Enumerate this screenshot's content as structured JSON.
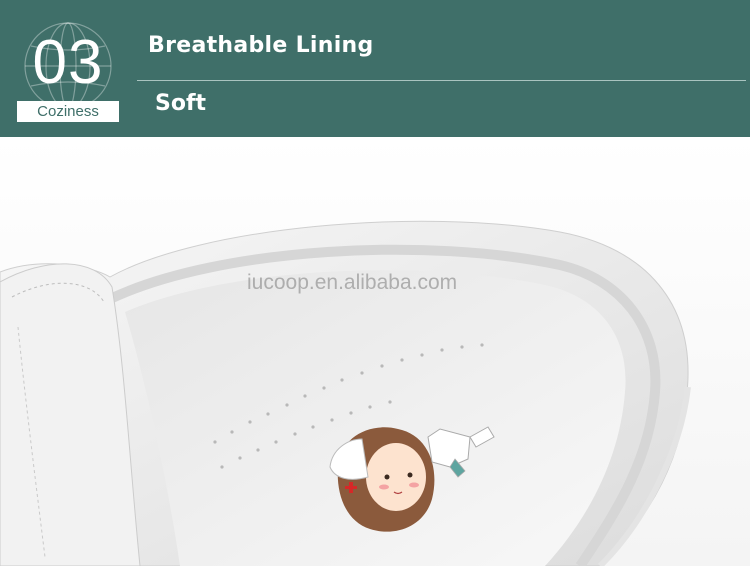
{
  "badge": {
    "number": "03",
    "label": "Coziness"
  },
  "banner": {
    "title": "Breathable Lining",
    "subtitle": "Soft",
    "color": "#3f6f69"
  },
  "photo": {
    "watermark": "iucoop.en.alibaba.com",
    "subject": "white nurse shoe insole with nurse cartoon print"
  }
}
